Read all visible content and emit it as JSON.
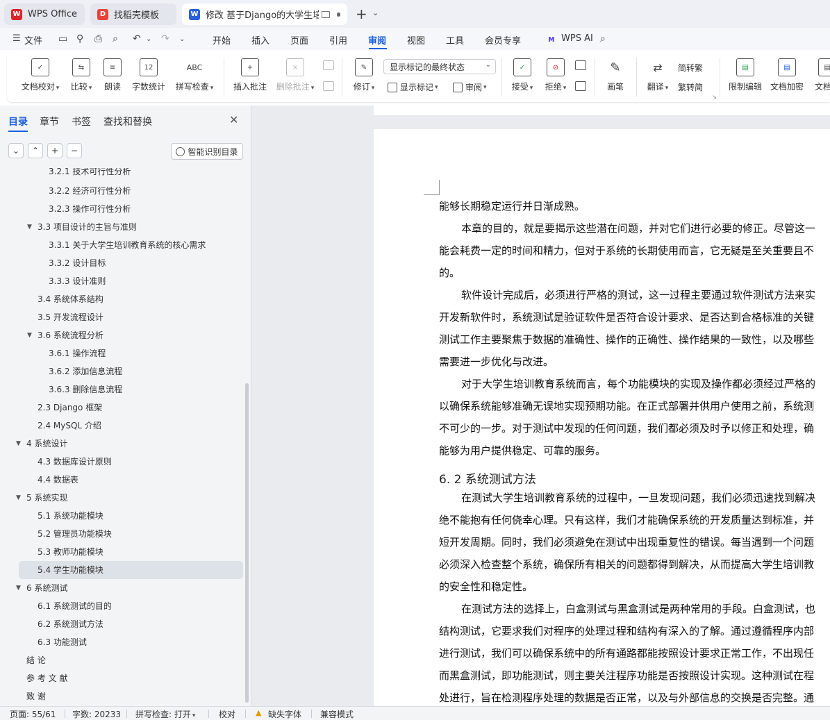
{
  "tabs": [
    {
      "label": "WPS Office",
      "icon": "wps-logo-icon",
      "color": "#d9262c"
    },
    {
      "label": "找稻壳模板",
      "icon": "docer-icon",
      "color": "#e8433a"
    },
    {
      "label": "修改 基于Django的大学生培训",
      "icon": "wps-writer-icon",
      "color": "#2b5fd9"
    }
  ],
  "menu": {
    "file": "文件",
    "items": [
      "开始",
      "插入",
      "页面",
      "引用",
      "审阅",
      "视图",
      "工具",
      "会员专享"
    ],
    "active": "审阅",
    "wps_ai": "WPS AI"
  },
  "ribbon": {
    "doc_proof": "文档校对",
    "compare": "比较",
    "read_aloud": "朗读",
    "word_count": "字数统计",
    "spell_check": "拼写检查",
    "insert_comment": "插入批注",
    "delete_comment": "删除批注",
    "revise": "修订",
    "markup_mode": "显示标记的最终状态",
    "show_markup": "显示标记",
    "review": "审阅",
    "accept": "接受",
    "reject": "拒绝",
    "pen": "画笔",
    "translate": "翻译",
    "to_traditional": "简转繁",
    "to_simplified": "繁转简",
    "restrict_edit": "限制编辑",
    "doc_encrypt": "文档加密",
    "doc_right": "文档权"
  },
  "sidebar": {
    "tabs": [
      "目录",
      "章节",
      "书签",
      "查找和替换"
    ],
    "active_tab": "目录",
    "smart_toc": "智能识别目录",
    "toc": [
      {
        "label": "3.2.1  技术可行性分析",
        "level": 3,
        "arrow": ""
      },
      {
        "label": "3.2.2  经济可行性分析",
        "level": 3,
        "arrow": ""
      },
      {
        "label": "3.2.3  操作可行性分析",
        "level": 3,
        "arrow": ""
      },
      {
        "label": "3.3  项目设计的主旨与准则",
        "level": 2,
        "arrow": "▼"
      },
      {
        "label": "3.3.1 关于大学生培训教育系统的核心需求",
        "level": 3,
        "arrow": ""
      },
      {
        "label": "3.3.2 设计目标",
        "level": 3,
        "arrow": ""
      },
      {
        "label": "3.3.3 设计准则",
        "level": 3,
        "arrow": ""
      },
      {
        "label": "3.4  系统体系结构",
        "level": 2,
        "arrow": ""
      },
      {
        "label": "3.5  开发流程设计",
        "level": 2,
        "arrow": ""
      },
      {
        "label": "3.6 系统流程分析",
        "level": 2,
        "arrow": "▼"
      },
      {
        "label": "3.6.1 操作流程",
        "level": 3,
        "arrow": ""
      },
      {
        "label": "3.6.2 添加信息流程",
        "level": 3,
        "arrow": ""
      },
      {
        "label": "3.6.3 删除信息流程",
        "level": 3,
        "arrow": ""
      },
      {
        "label": "2.3 Django 框架",
        "level": 2,
        "arrow": ""
      },
      {
        "label": "2.4 MySQL 介绍",
        "level": 2,
        "arrow": ""
      },
      {
        "label": "4  系统设计",
        "level": 1,
        "arrow": "▼"
      },
      {
        "label": "4.3  数据库设计原则",
        "level": 2,
        "arrow": ""
      },
      {
        "label": "4.4  数据表",
        "level": 2,
        "arrow": ""
      },
      {
        "label": "5  系统实现",
        "level": 1,
        "arrow": "▼"
      },
      {
        "label": "5.1 系统功能模块",
        "level": 2,
        "arrow": ""
      },
      {
        "label": "5.2 管理员功能模块",
        "level": 2,
        "arrow": ""
      },
      {
        "label": "5.3 教师功能模块",
        "level": 2,
        "arrow": ""
      },
      {
        "label": "5.4 学生功能模块",
        "level": 2,
        "arrow": "",
        "highlight": true
      },
      {
        "label": "6  系统测试",
        "level": 1,
        "arrow": "▼"
      },
      {
        "label": "6.1 系统测试的目的",
        "level": 2,
        "arrow": ""
      },
      {
        "label": "6.2 系统测试方法",
        "level": 2,
        "arrow": ""
      },
      {
        "label": "6.3 功能测试",
        "level": 2,
        "arrow": ""
      },
      {
        "label": "结  论",
        "level": 1,
        "arrow": ""
      },
      {
        "label": "参 考 文 献",
        "level": 1,
        "arrow": ""
      },
      {
        "label": "致  谢",
        "level": 1,
        "arrow": ""
      }
    ]
  },
  "document": {
    "lines": [
      {
        "text": "能够长期稳定运行并日渐成熟。",
        "indent": false
      },
      {
        "text": "本章的目的，就是要揭示这些潜在问题，并对它们进行必要的修正。尽管这一",
        "indent": true
      },
      {
        "text": "能会耗费一定的时间和精力，但对于系统的长期使用而言，它无疑是至关重要且不",
        "indent": false
      },
      {
        "text": "的。",
        "indent": false
      },
      {
        "text": "软件设计完成后，必须进行严格的测试，这一过程主要通过软件测试方法来实",
        "indent": true
      },
      {
        "text": "开发新软件时，系统测试是验证软件是否符合设计要求、是否达到合格标准的关键",
        "indent": false
      },
      {
        "text": "测试工作主要聚焦于数据的准确性、操作的正确性、操作结果的一致性，以及哪些",
        "indent": false
      },
      {
        "text": "需要进一步优化与改进。",
        "indent": false
      },
      {
        "text": "对于大学生培训教育系统而言，每个功能模块的实现及操作都必须经过严格的",
        "indent": true
      },
      {
        "text": "以确保系统能够准确无误地实现预期功能。在正式部署并供用户使用之前，系统测",
        "indent": false
      },
      {
        "text": "不可少的一步。对于测试中发现的任何问题，我们都必须及时予以修正和处理，确",
        "indent": false
      },
      {
        "text": "能够为用户提供稳定、可靠的服务。",
        "indent": false
      },
      {
        "text": "6. 2 系统测试方法",
        "heading": true
      },
      {
        "text": "在测试大学生培训教育系统的过程中，一旦发现问题，我们必须迅速找到解决",
        "indent": true
      },
      {
        "text": "绝不能抱有任何侥幸心理。只有这样，我们才能确保系统的开发质量达到标准，并",
        "indent": false
      },
      {
        "text": "短开发周期。同时，我们必须避免在测试中出现重复性的错误。每当遇到一个问题",
        "indent": false
      },
      {
        "text": "必须深入检查整个系统，确保所有相关的问题都得到解决，从而提高大学生培训教",
        "indent": false
      },
      {
        "text": "的安全性和稳定性。",
        "indent": false
      },
      {
        "text": "在测试方法的选择上，白盒测试与黑盒测试是两种常用的手段。白盒测试，也",
        "indent": true
      },
      {
        "text": "结构测试，它要求我们对程序的处理过程和结构有深入的了解。通过遵循程序内部",
        "indent": false
      },
      {
        "text": "进行测试，我们可以确保系统中的所有通路都能按照设计要求正常工作，不出现任",
        "indent": false
      },
      {
        "text": "而黑盒测试，即功能测试，则主要关注程序功能是否按照设计实现。这种测试在程",
        "indent": false
      },
      {
        "text": "处进行，旨在检测程序处理的数据是否正常，以及与外部信息的交换是否完整。通",
        "indent": false
      }
    ]
  },
  "status": {
    "page": "页面: 55/61",
    "words": "字数: 20233",
    "spell": "拼写检查: 打开",
    "proof": "校对",
    "missing_font": "缺失字体",
    "compat": "兼容模式"
  }
}
